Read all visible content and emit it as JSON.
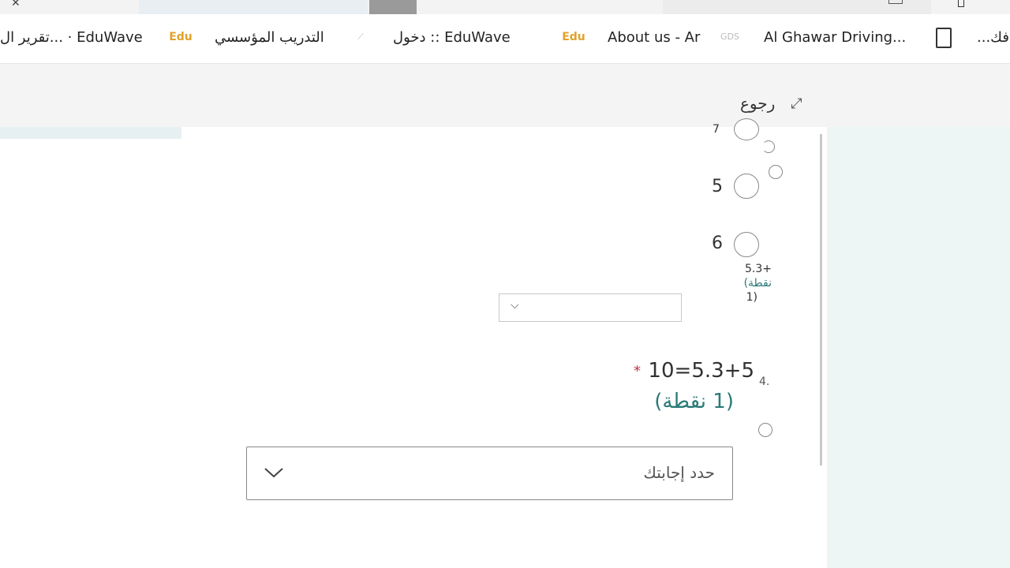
{
  "bookmarks": {
    "items": [
      {
        "label": "تقرير ال... · EduWave",
        "icon": "eduwave-icon"
      },
      {
        "label": "التدريب المؤسسي",
        "icon": "bookmark-icon"
      },
      {
        "label": "دخول :: EduWave",
        "icon": "eduwave-icon"
      },
      {
        "label": "About us - Ar",
        "icon": "gds-icon"
      },
      {
        "label": "Al Ghawar Driving...",
        "icon": "page-icon"
      },
      {
        "label": "...فك",
        "icon": ""
      }
    ]
  },
  "toolbar": {
    "back_label": "رجوع"
  },
  "question3": {
    "options": [
      "7",
      "5",
      "6"
    ],
    "number": "5.3+",
    "points": "(نقطة",
    "points_num": "1)",
    "answer_value": ""
  },
  "question4": {
    "number": "4.",
    "title": "5.3+5=10",
    "required_mark": "*",
    "points": "(1 نقطة)",
    "placeholder": "حدد إجابتك"
  },
  "colors": {
    "accent": "#2b7a78",
    "required": "#c4314b",
    "pane": "#edf5f5"
  }
}
